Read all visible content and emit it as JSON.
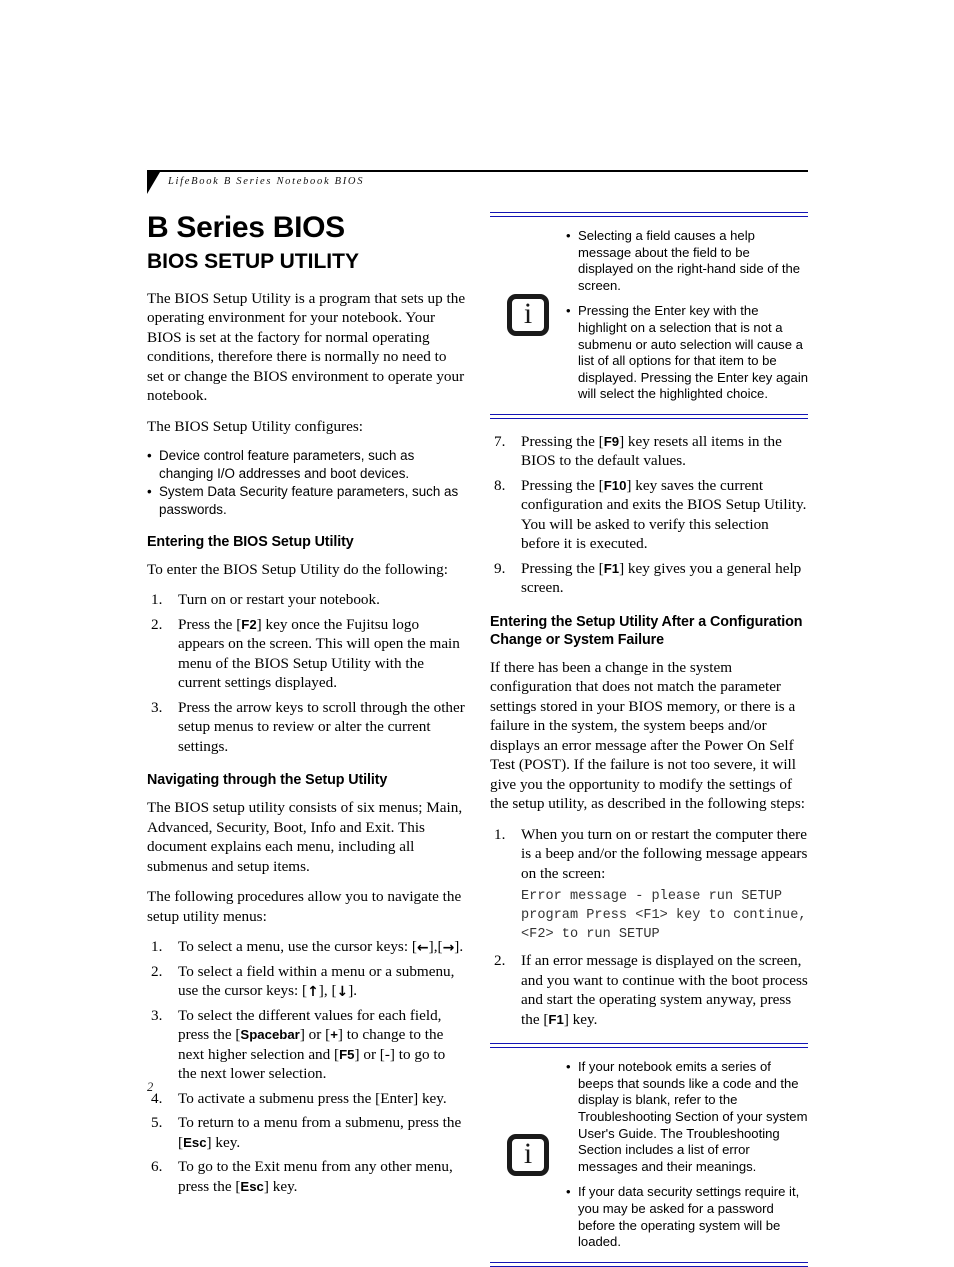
{
  "header": {
    "running_head": "LifeBook B Series Notebook BIOS"
  },
  "footer": {
    "page_number": "2"
  },
  "colors": {
    "note_rule": "#1414b4",
    "text": "#000000"
  },
  "title": {
    "main": "B Series BIOS",
    "sub": "BIOS SETUP UTILITY"
  },
  "left_column": {
    "intro_paragraph": "The BIOS Setup Utility is a program that sets up the operating environment for your notebook. Your BIOS is set at the factory for normal operating conditions, therefore there is normally no need to set or change the BIOS environment to operate your notebook.",
    "configures_lead": "The BIOS Setup Utility configures:",
    "configures_bullets": [
      "Device control feature parameters, such as changing I/O addresses and boot devices.",
      "System Data Security feature parameters, such as passwords."
    ],
    "entering_heading": "Entering the BIOS Setup Utility",
    "entering_lead": "To enter the BIOS Setup Utility do the following:",
    "entering_steps": [
      {
        "num": "1.",
        "pre": "Turn on or restart your notebook.",
        "key": "",
        "post": ""
      },
      {
        "num": "2.",
        "pre": "Press the [",
        "key": "F2",
        "post": "] key once the Fujitsu logo appears on the screen. This will open the main menu of the BIOS Setup Utility with the current settings displayed."
      },
      {
        "num": "3.",
        "pre": "Press the arrow keys to scroll through the other setup menus to review or alter the current settings.",
        "key": "",
        "post": ""
      }
    ],
    "navigating_heading": "Navigating through the Setup Utility",
    "navigating_paragraph": "The BIOS setup utility consists of six menus; Main, Advanced, Security, Boot, Info and Exit. This document explains each menu, including all submenus and setup items.",
    "procedures_lead": "The following procedures allow you to navigate the setup utility menus:",
    "nav_steps": [
      {
        "num": "1.",
        "text_before": "To select a menu, use the cursor keys: [",
        "arrow1": "←",
        "text_mid": "],[",
        "arrow2": "→",
        "text_after": "]."
      },
      {
        "num": "2.",
        "text_before": "To select a field within a menu or a submenu, use the cursor keys: [",
        "arrow1": "↑",
        "text_mid": "], [",
        "arrow2": "↓",
        "text_after": "]."
      }
    ],
    "nav_step3": {
      "num": "3.",
      "p1": "To select the different values for each field, press the [",
      "k1": "Spacebar",
      "p2": "] or [",
      "k2": "+",
      "p3": "] to change to the next higher selection and [",
      "k3": "F5",
      "p4": "] or [-] to go to the next lower selection."
    },
    "nav_step4": {
      "num": "4.",
      "text": "To activate a submenu press the [Enter] key."
    },
    "nav_step5": {
      "num": "5.",
      "p1": "To return to a menu from a submenu, press the [",
      "k1": "Esc",
      "p2": "] key."
    },
    "nav_step6": {
      "num": "6.",
      "p1": "To go to the Exit menu from any other menu, press the [",
      "k1": "Esc",
      "p2": "] key."
    }
  },
  "right_column": {
    "note_top": {
      "icon": "info-icon",
      "bullets": [
        "Selecting a field causes a help message about the field to be displayed on the right-hand side of the screen.",
        "Pressing the Enter key with the highlight on a selection that is not a submenu or auto selection will cause a list of all options for that item to be displayed. Pressing the Enter key again will select the highlighted choice."
      ]
    },
    "steps_continued": [
      {
        "num": "7.",
        "p1": "Pressing the [",
        "k1": "F9",
        "p2": "] key resets all items in the BIOS to the default values."
      },
      {
        "num": "8.",
        "p1": "Pressing the [",
        "k1": "F10",
        "p2": "] key saves the current configuration and exits the BIOS Setup Utility. You will be asked to verify this selection before it is executed."
      },
      {
        "num": "9.",
        "p1": "Pressing the [",
        "k1": "F1",
        "p2": "] key gives you a general help screen."
      }
    ],
    "failure_heading": "Entering the Setup Utility After a Configuration Change or System Failure",
    "failure_paragraph": "If there has been a change in the system configuration that does not match the parameter settings stored in your BIOS memory, or there is a failure in the system, the system beeps and/or displays an error message after the Power On Self Test (POST). If the failure is not too severe, it will give you the opportunity to modify the settings of the setup utility, as described in the following steps:",
    "failure_step1": {
      "num": "1.",
      "text": "When you turn on or restart the computer there is a beep and/or the following message appears on the screen:"
    },
    "error_message": "Error message - please run SETUP\nprogram Press <F1> key to continue,\n<F2> to run SETUP",
    "failure_step2": {
      "num": "2.",
      "p1": "If an error message is displayed on the screen, and you want to continue with the boot process and start the operating system anyway, press the [",
      "k1": "F1",
      "p2": "] key."
    },
    "note_bottom": {
      "icon": "info-icon",
      "bullets": [
        "If your notebook emits a series of beeps that sounds like a code and the display is blank, refer to the Troubleshooting Section of your system User's Guide. The Troubleshooting Section includes a list of error messages and their meanings.",
        "If your data security settings require it, you may be asked for a password before the operating system will be loaded."
      ]
    }
  }
}
